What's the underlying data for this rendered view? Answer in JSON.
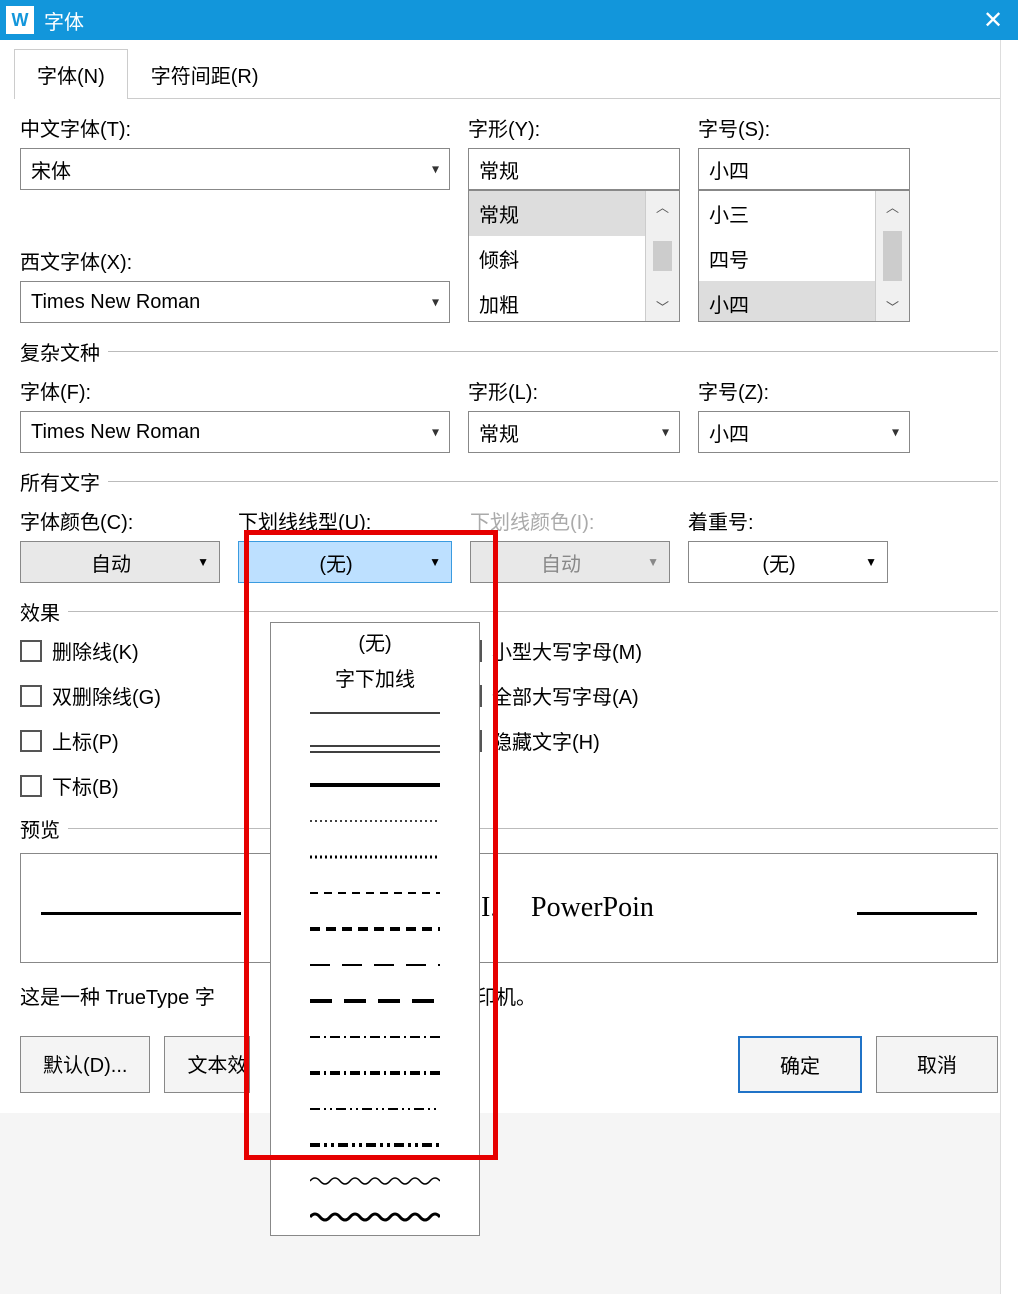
{
  "titlebar": {
    "app_icon": "W",
    "title": "字体",
    "close": "✕"
  },
  "tabs": {
    "font": "字体(N)",
    "spacing": "字符间距(R)"
  },
  "chinese_font": {
    "label": "中文字体(T):",
    "value": "宋体"
  },
  "latin_font": {
    "label": "西文字体(X):",
    "value": "Times New Roman"
  },
  "font_style": {
    "label": "字形(Y):",
    "value": "常规",
    "options": [
      "常规",
      "倾斜",
      "加粗"
    ]
  },
  "font_size": {
    "label": "字号(S):",
    "value": "小四",
    "options": [
      "小三",
      "四号",
      "小四"
    ]
  },
  "complex": {
    "group": "复杂文种",
    "font_label": "字体(F):",
    "font_value": "Times New Roman",
    "style_label": "字形(L):",
    "style_value": "常规",
    "size_label": "字号(Z):",
    "size_value": "小四"
  },
  "all_text": {
    "group": "所有文字",
    "color_label": "字体颜色(C):",
    "color_value": "自动",
    "underline_label": "下划线线型(U):",
    "underline_value": "(无)",
    "underline_color_label": "下划线颜色(I):",
    "underline_color_value": "自动",
    "emphasis_label": "着重号:",
    "emphasis_value": "(无)"
  },
  "underline_menu": {
    "none": "(无)",
    "words_only": "字下加线"
  },
  "effects": {
    "group": "效果",
    "strike": "删除线(K)",
    "dstrike": "双删除线(G)",
    "super": "上标(P)",
    "sub": "下标(B)",
    "smallcaps": "小型大写字母(M)",
    "allcaps": "全部大写字母(A)",
    "hidden": "隐藏文字(H)"
  },
  "preview": {
    "group": "预览",
    "text_left": "I.",
    "text_right": "PowerPoin"
  },
  "truetype_left": "这是一种 TrueType 字",
  "truetype_right": "和打印机。",
  "buttons": {
    "default": "默认(D)...",
    "texteffect": "文本效果",
    "ok": "确定",
    "cancel": "取消"
  }
}
